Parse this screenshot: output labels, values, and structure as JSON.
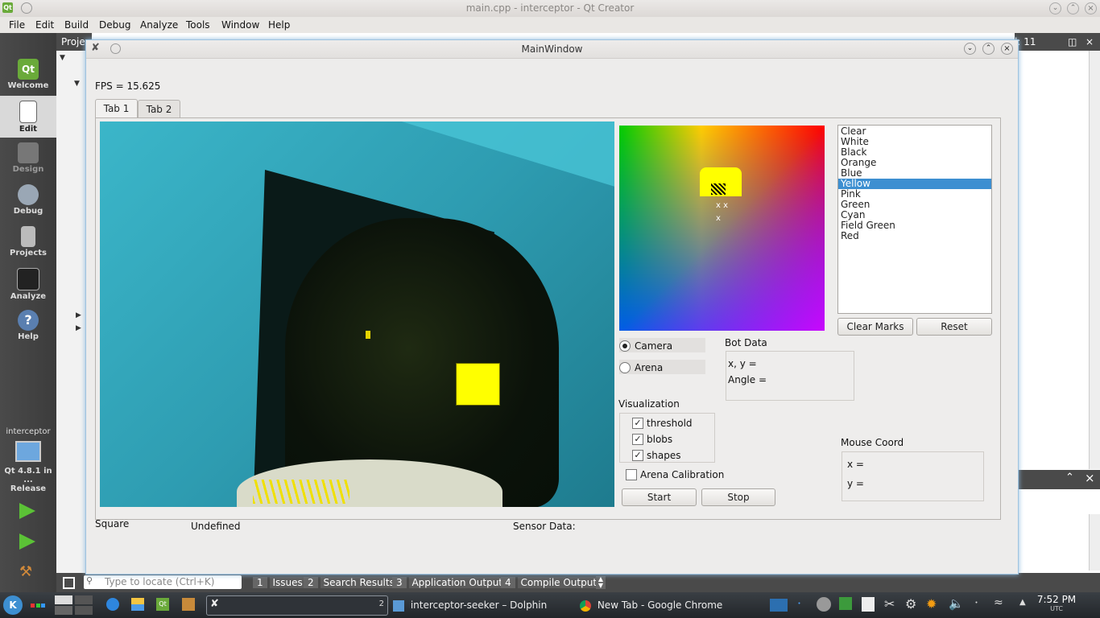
{
  "qtcreator": {
    "window_title": "main.cpp - interceptor - Qt Creator",
    "menu": [
      "File",
      "Edit",
      "Build",
      "Debug",
      "Analyze",
      "Tools",
      "Window",
      "Help"
    ],
    "projects_label": "Proje",
    "line_label": "l: 11",
    "sidebar": [
      {
        "label": "Welcome"
      },
      {
        "label": "Edit"
      },
      {
        "label": "Design"
      },
      {
        "label": "Debug"
      },
      {
        "label": "Projects"
      },
      {
        "label": "Analyze"
      },
      {
        "label": "Help"
      }
    ],
    "kit": {
      "project": "interceptor",
      "target": "Qt 4.8.1 in ...",
      "build": "Release"
    },
    "locate_placeholder": "Type to locate (Ctrl+K)",
    "output_tabs": [
      {
        "num": "1",
        "label": "Issues"
      },
      {
        "num": "2",
        "label": "Search Results"
      },
      {
        "num": "3",
        "label": "Application Output"
      },
      {
        "num": "4",
        "label": "Compile Output"
      }
    ]
  },
  "mainwindow": {
    "title": "MainWindow",
    "fps": "FPS = 15.625",
    "tabs": [
      "Tab 1",
      "Tab 2"
    ],
    "colors": [
      "Clear",
      "White",
      "Black",
      "Orange",
      "Blue",
      "Yellow",
      "Pink",
      "Green",
      "Cyan",
      "Field Green",
      "Red"
    ],
    "selected_color": "Yellow",
    "clear_marks_label": "Clear Marks",
    "reset_label": "Reset",
    "source": {
      "camera": "Camera",
      "arena": "Arena",
      "selected": "Camera"
    },
    "bot_data": {
      "title": "Bot Data",
      "xy": "x, y =",
      "angle": "Angle ="
    },
    "visualization": {
      "title": "Visualization",
      "threshold": "threshold",
      "blobs": "blobs",
      "shapes": "shapes"
    },
    "arena_calibration": "Arena Calibration",
    "start_label": "Start",
    "stop_label": "Stop",
    "mouse_coord": {
      "title": "Mouse Coord",
      "x": "x =",
      "y": "y ="
    },
    "shape_label": "Square",
    "shape_value": "Undefined",
    "sensor_label": "Sensor Data:",
    "hue_marks": [
      "x x",
      "x"
    ]
  },
  "taskbar": {
    "dolphin": "interceptor-seeker – Dolphin",
    "chrome": "New Tab - Google Chrome",
    "pager": "2",
    "time": "7:52 PM",
    "tz": "UTC"
  },
  "accent": "#3d8fd1"
}
